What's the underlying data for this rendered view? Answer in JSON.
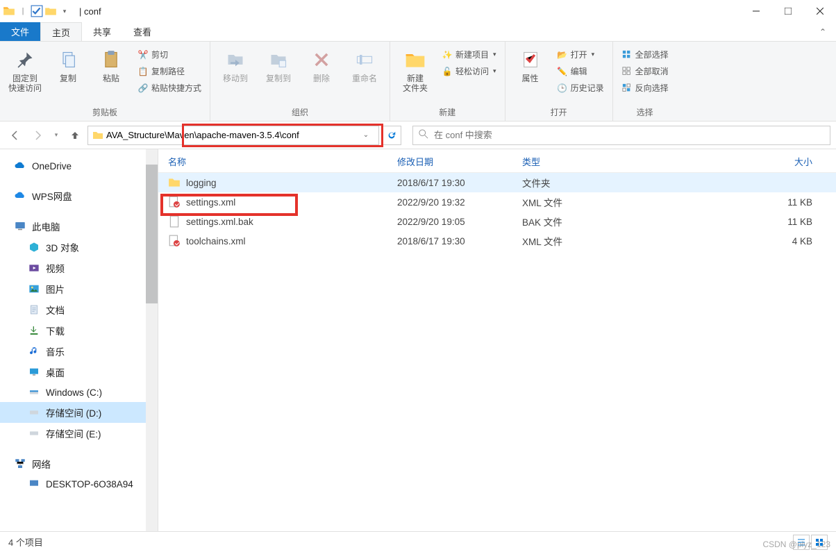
{
  "window": {
    "title_prefix": "| conf",
    "tabs": {
      "file": "文件",
      "home": "主页",
      "share": "共享",
      "view": "查看"
    }
  },
  "ribbon": {
    "groups": {
      "clipboard": {
        "label": "剪贴板",
        "pin": "固定到\n快速访问",
        "copy": "复制",
        "paste": "粘贴",
        "cut": "剪切",
        "copy_path": "复制路径",
        "paste_shortcut": "粘贴快捷方式"
      },
      "organize": {
        "label": "组织",
        "move_to": "移动到",
        "copy_to": "复制到",
        "delete": "删除",
        "rename": "重命名"
      },
      "new": {
        "label": "新建",
        "new_folder": "新建\n文件夹",
        "new_item": "新建项目",
        "easy_access": "轻松访问"
      },
      "open": {
        "label": "打开",
        "properties": "属性",
        "open": "打开",
        "edit": "编辑",
        "history": "历史记录"
      },
      "select": {
        "label": "选择",
        "select_all": "全部选择",
        "select_none": "全部取消",
        "invert": "反向选择"
      }
    }
  },
  "nav": {
    "path_prefix": "AVA_Structure",
    "path_value": "\\Maven\\apache-maven-3.5.4\\conf",
    "search_placeholder": "在 conf 中搜索"
  },
  "sidebar": {
    "onedrive": "OneDrive",
    "wps": "WPS网盘",
    "this_pc": "此电脑",
    "objects_3d": "3D 对象",
    "videos": "视频",
    "pictures": "图片",
    "documents": "文档",
    "downloads": "下载",
    "music": "音乐",
    "desktop": "桌面",
    "c_drive": "Windows (C:)",
    "d_drive": "存储空间 (D:)",
    "e_drive": "存储空间 (E:)",
    "network": "网络",
    "remote_pc": "DESKTOP-6O38A94"
  },
  "columns": {
    "name": "名称",
    "modified": "修改日期",
    "type": "类型",
    "size": "大小"
  },
  "files": [
    {
      "icon": "folder",
      "name": "logging",
      "modified": "2018/6/17 19:30",
      "type": "文件夹",
      "size": ""
    },
    {
      "icon": "xml-edit",
      "name": "settings.xml",
      "modified": "2022/9/20 19:32",
      "type": "XML 文件",
      "size": "11 KB"
    },
    {
      "icon": "file",
      "name": "settings.xml.bak",
      "modified": "2022/9/20 19:05",
      "type": "BAK 文件",
      "size": "11 KB"
    },
    {
      "icon": "xml-edit",
      "name": "toolchains.xml",
      "modified": "2018/6/17 19:30",
      "type": "XML 文件",
      "size": "4 KB"
    }
  ],
  "status": {
    "count": "4 个项目"
  },
  "watermark": "CSDN @plyz_123"
}
